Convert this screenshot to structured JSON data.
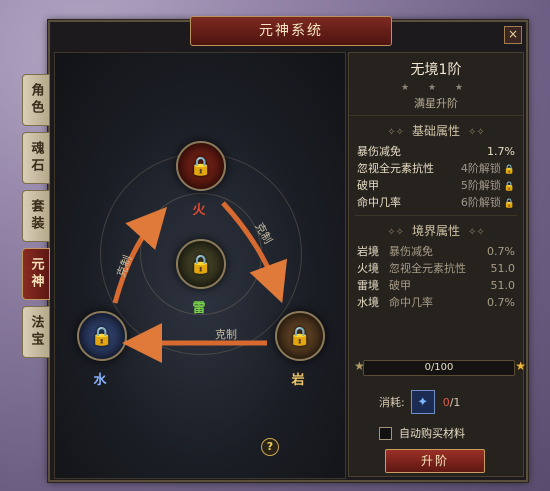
{
  "window": {
    "title": "元神系统",
    "close_label": "×"
  },
  "side_tabs": [
    {
      "label": "角色"
    },
    {
      "label": "魂石"
    },
    {
      "label": "套装"
    },
    {
      "label": "元神"
    },
    {
      "label": "法宝"
    }
  ],
  "active_tab": "元神",
  "nodes": {
    "fire": {
      "label": "火",
      "color": "#e04a2e"
    },
    "thunder": {
      "label": "雷",
      "color": "#78d04a"
    },
    "water": {
      "label": "水",
      "color": "#8ab4ff"
    },
    "rock": {
      "label": "岩",
      "color": "#f0c766"
    }
  },
  "relations": {
    "fire_to_rock": "克制",
    "rock_to_water": "克制",
    "water_to_fire": "克制"
  },
  "help_label": "?",
  "panel": {
    "realm_title": "无境1阶",
    "stars": "★ ★ ★",
    "stars_status": "满星升阶",
    "basic_title": "基础属性",
    "basic_attrs": [
      {
        "name": "暴伤减免",
        "value": "1.7%",
        "locked": false
      },
      {
        "name": "忽视全元素抗性",
        "value": "4阶解锁",
        "locked": true
      },
      {
        "name": "破甲",
        "value": "5阶解锁",
        "locked": true
      },
      {
        "name": "命中几率",
        "value": "6阶解锁",
        "locked": true
      }
    ],
    "realm_attrs_title": "境界属性",
    "realm_attrs": [
      {
        "realm": "岩境",
        "name": "暴伤减免",
        "value": "0.7%"
      },
      {
        "realm": "火境",
        "name": "忽视全元素抗性",
        "value": "51.0"
      },
      {
        "realm": "雷境",
        "name": "破甲",
        "value": "51.0"
      },
      {
        "realm": "水境",
        "name": "命中几率",
        "value": "0.7%"
      }
    ],
    "progress_text": "0/100",
    "progress_value": 0,
    "cost_label": "消耗:",
    "cost_have": "0",
    "cost_need": "/1",
    "auto_buy_label": "自动购买材料",
    "auto_buy_checked": false,
    "upgrade_label": "升阶"
  }
}
